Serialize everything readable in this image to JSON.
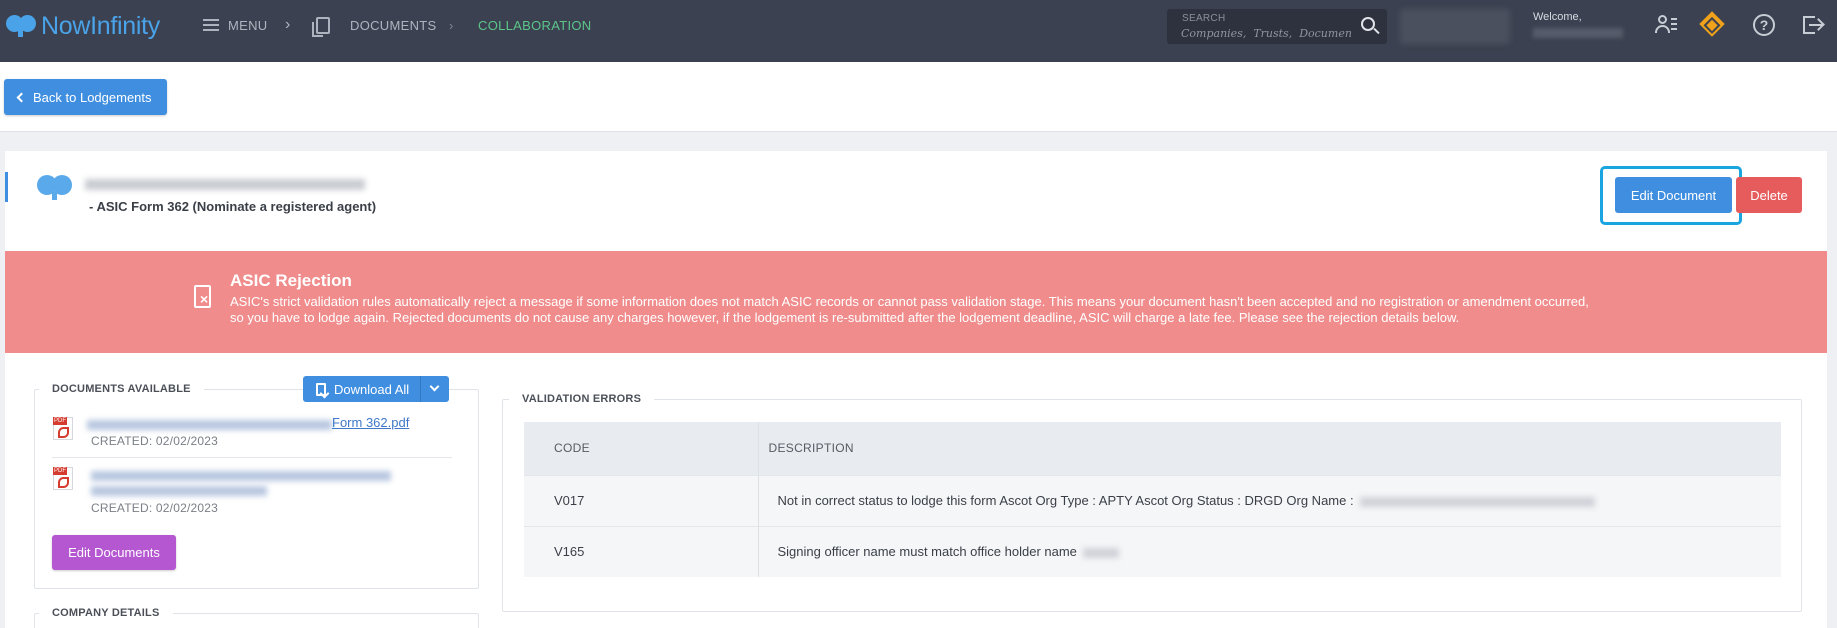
{
  "header": {
    "logo_now": "Now",
    "logo_infinity": "Infinity",
    "nav": {
      "menu": "MENU",
      "documents": "DOCUMENTS",
      "collaboration": "COLLABORATION"
    },
    "search": {
      "label": "SEARCH",
      "placeholder": "Companies,  Trusts,  Documents"
    },
    "welcome": "Welcome,"
  },
  "back_button": "Back to Lodgements",
  "document": {
    "subtitle": "- ASIC Form 362 (Nominate a registered agent)",
    "edit_button": "Edit Document",
    "delete_button": "Delete"
  },
  "rejection": {
    "title": "ASIC Rejection",
    "line1": "ASIC's strict validation rules automatically reject a message if some information does not match ASIC records or cannot pass validation stage. This means your document hasn't been accepted and no registration or amendment occurred,",
    "line2": "so you have to lodge again. Rejected documents do not cause any charges however, if the lodgement is re-submitted after the lodgement deadline, ASIC will charge a late fee. Please see the rejection details below."
  },
  "documents_available": {
    "legend": "DOCUMENTS AVAILABLE",
    "download_button": "Download All",
    "items": [
      {
        "link": "Form 362.pdf",
        "created": "CREATED: 02/02/2023"
      },
      {
        "link": "",
        "created": "CREATED: 02/02/2023"
      }
    ],
    "edit_button": "Edit Documents"
  },
  "company_details": {
    "legend": "COMPANY DETAILS"
  },
  "validation_errors": {
    "legend": "VALIDATION ERRORS",
    "columns": [
      "CODE",
      "DESCRIPTION"
    ],
    "rows": [
      {
        "code": "V017",
        "description": "Not in correct status to lodge this form Ascot Org Type : APTY Ascot Org Status : DRGD Org Name :"
      },
      {
        "code": "V165",
        "description": "Signing officer name must match office holder name"
      }
    ]
  },
  "colors": {
    "topbar": "#3b4150",
    "accent_blue": "#3f8ee0",
    "danger": "#e65b5b",
    "rejection_banner": "#f08c8c",
    "purple": "#b457d0",
    "collab_green": "#5cc58a"
  },
  "icons": [
    "menu-icon",
    "documents-icon",
    "search-icon",
    "user-list-icon",
    "diamond-icon",
    "help-icon",
    "logout-icon",
    "chevron-left-icon",
    "reject-document-icon",
    "download-icon",
    "chevron-down-icon",
    "pdf-icon"
  ]
}
